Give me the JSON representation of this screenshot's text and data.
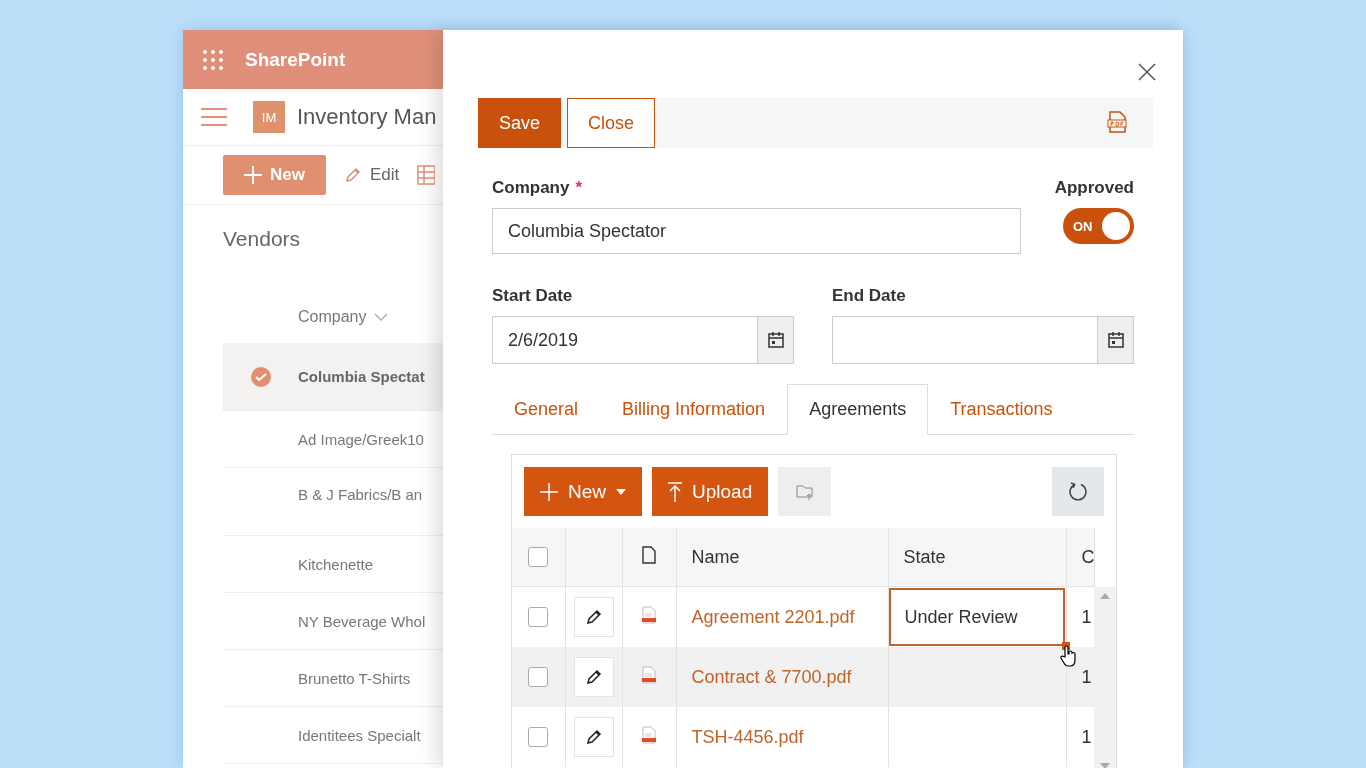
{
  "sharepoint": {
    "app_name": "SharePoint",
    "site_initials": "IM",
    "site_title": "Inventory Man",
    "toolbar": [
      {
        "kind": "new",
        "label": "New"
      },
      {
        "kind": "edit",
        "label": "Edit"
      },
      {
        "kind": "grid"
      }
    ],
    "list_title": "Vendors",
    "column": "Company",
    "items": [
      {
        "name": "Columbia Spectat",
        "selected": true
      },
      {
        "name": "Ad Image/Greek10",
        "selected": false
      },
      {
        "name": "B & J Fabrics/B an",
        "selected": false
      },
      {
        "name": "Kitchenette",
        "selected": false
      },
      {
        "name": "NY Beverage Whol",
        "selected": false
      },
      {
        "name": "Brunetto T-Shirts",
        "selected": false
      },
      {
        "name": "Identitees Specialt",
        "selected": false
      }
    ]
  },
  "form": {
    "buttons": [
      {
        "kind": "primary",
        "label": "Save"
      },
      {
        "kind": "outline",
        "label": "Close"
      }
    ],
    "company": {
      "label": "Company",
      "required": true,
      "required_mark": "*",
      "value": "Columbia Spectator"
    },
    "approved": {
      "label": "Approved",
      "on": true,
      "toggle_text": "ON"
    },
    "start_date": {
      "label": "Start Date",
      "value": "2/6/2019"
    },
    "end_date": {
      "label": "End Date"
    },
    "tabs": [
      {
        "label": "General",
        "selected": false
      },
      {
        "label": "Billing Information",
        "selected": false
      },
      {
        "label": "Agreements",
        "selected": true
      },
      {
        "label": "Transactions",
        "selected": false
      }
    ],
    "grid": {
      "toolbar": [
        {
          "kind": "new",
          "label": "New"
        },
        {
          "kind": "upload",
          "label": "Upload"
        },
        {
          "kind": "folder",
          "disabled": true
        },
        {
          "kind": "refresh"
        }
      ],
      "all_checked": false,
      "columns": [
        "Name",
        "State",
        "C"
      ],
      "rows": [
        {
          "checked": false,
          "hovered": false,
          "name": "Agreement 2201.pdf",
          "state": "Under Review",
          "state_selected": true,
          "column_4": "1"
        },
        {
          "checked": false,
          "hovered": true,
          "name": "Contract & 7700.pdf",
          "state_selected": false,
          "column_4": "1"
        },
        {
          "checked": false,
          "hovered": false,
          "name": "TSH-4456.pdf",
          "state_selected": false,
          "column_4": "1"
        }
      ]
    }
  }
}
